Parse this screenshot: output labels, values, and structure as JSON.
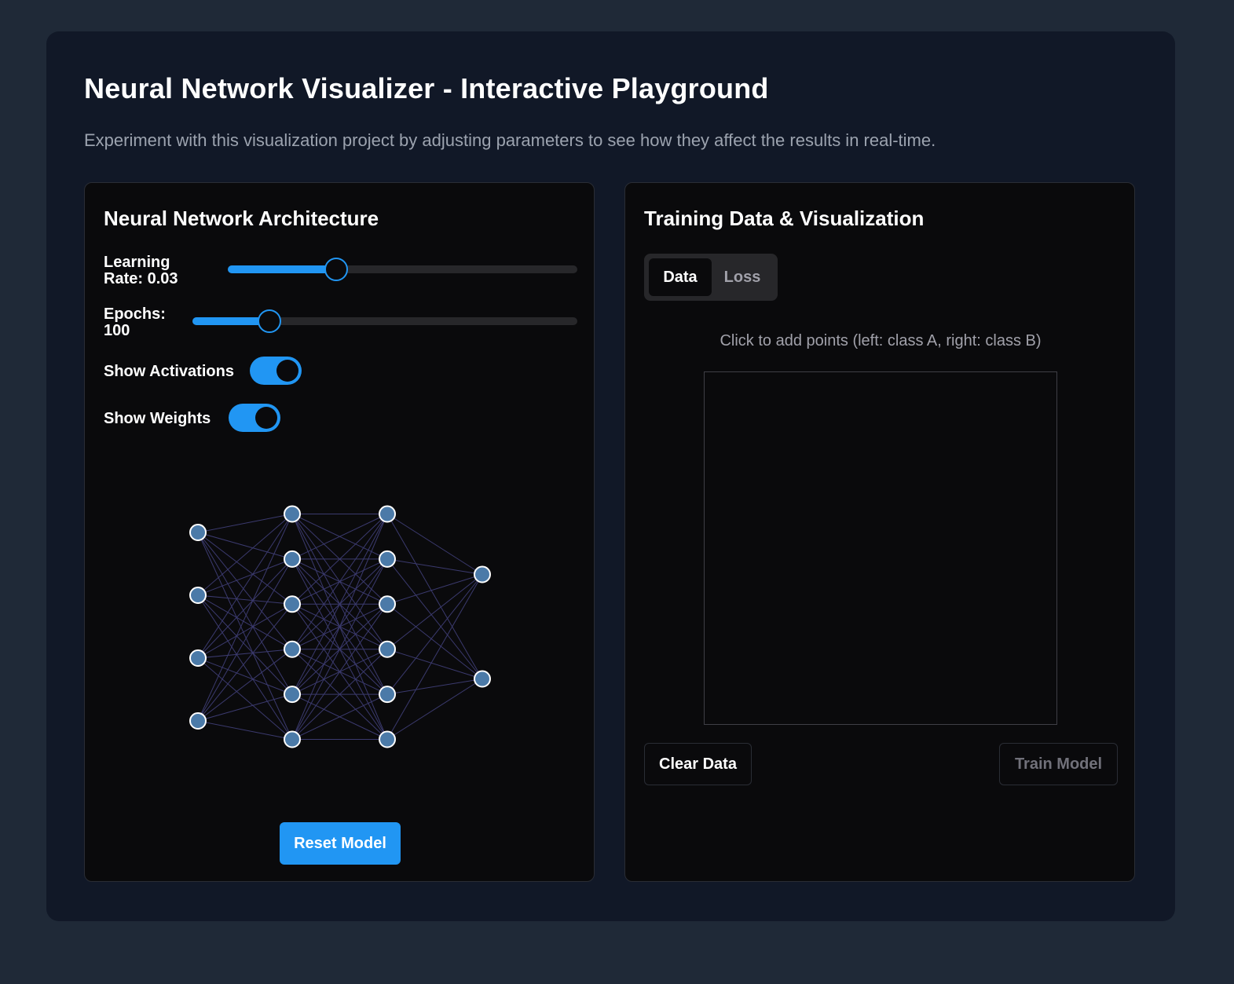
{
  "page": {
    "title": "Neural Network Visualizer - Interactive Playground",
    "subtitle": "Experiment with this visualization project by adjusting parameters to see how they affect the results in real-time."
  },
  "architecture": {
    "title": "Neural Network Architecture",
    "learning_rate": {
      "label_line1": "Learning",
      "label_line2": "Rate: 0.03",
      "value": 0.03,
      "fraction": 0.31
    },
    "epochs": {
      "label_line1": "Epochs:",
      "label_line2": "100",
      "value": 100,
      "fraction": 0.2
    },
    "show_activations": {
      "label": "Show Activations",
      "on": true
    },
    "show_weights": {
      "label": "Show Weights",
      "on": true
    },
    "network": {
      "layers": [
        4,
        6,
        6,
        2
      ],
      "node_color": "#4b7aa8",
      "edge_color": "#3b3a6e"
    },
    "reset_label": "Reset Model"
  },
  "training": {
    "title": "Training Data & Visualization",
    "tabs": [
      {
        "label": "Data",
        "active": true
      },
      {
        "label": "Loss",
        "active": false
      }
    ],
    "hint": "Click to add points (left: class A, right: class B)",
    "clear_label": "Clear Data",
    "train_label": "Train Model"
  },
  "colors": {
    "accent": "#2196f3",
    "background": "#1f2937",
    "card": "#111827",
    "panel": "#0a0a0c"
  }
}
